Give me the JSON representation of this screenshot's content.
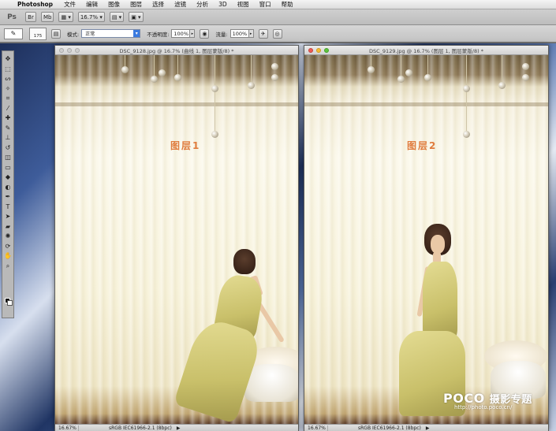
{
  "menubar": {
    "app_name": "Photoshop",
    "items": [
      "文件",
      "编辑",
      "图像",
      "图层",
      "选择",
      "滤镜",
      "分析",
      "3D",
      "视图",
      "窗口",
      "帮助"
    ]
  },
  "appbar": {
    "ps_label": "Ps",
    "zoom_value": "16.7%"
  },
  "options": {
    "brush_size": "175",
    "mode_label": "模式:",
    "mode_value": "正常",
    "opacity_label": "不透明度:",
    "opacity_value": "100%",
    "flow_label": "流量:",
    "flow_value": "100%"
  },
  "documents": [
    {
      "title": "DSC_9128.jpg @ 16.7% (曲线 1, 图层蒙版/8) *",
      "layer_label": "图层1",
      "zoom": "16.67%",
      "profile": "sRGB IEC61966-2.1 (8bpc)"
    },
    {
      "title": "DSC_9129.jpg @ 16.7% (图层 1, 图层蒙版/8) *",
      "layer_label": "图层2",
      "zoom": "16.67%",
      "profile": "sRGB IEC61966-2.1 (8bpc)"
    }
  ],
  "watermark": {
    "brand": "POCO",
    "brand_cn": "摄影专题",
    "url": "http://photo.poco.cn/"
  },
  "colors": {
    "layer_label": "#e07c3e",
    "close": "#ee5b53",
    "minimize": "#f5bd33",
    "zoom": "#5fc43e"
  }
}
